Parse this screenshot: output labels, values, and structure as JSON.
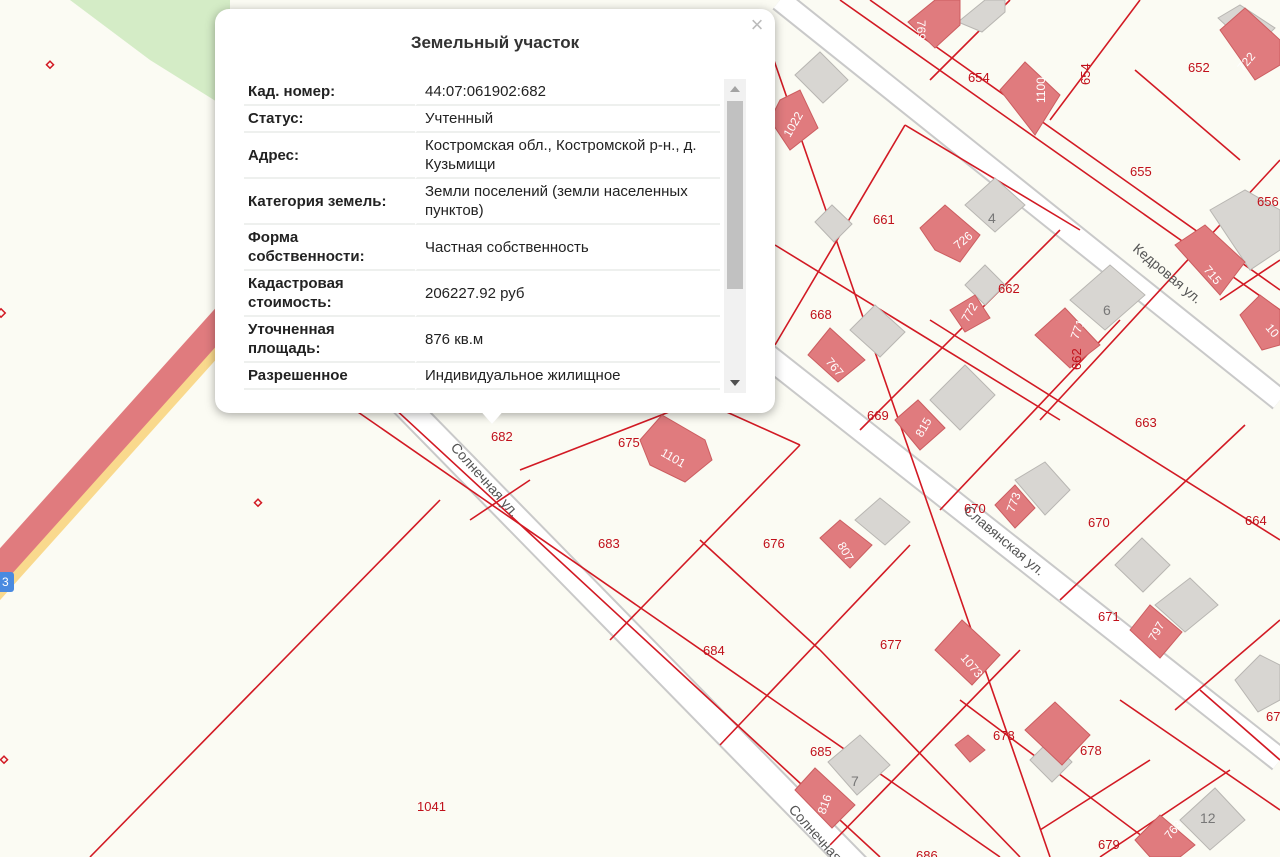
{
  "popup": {
    "title": "Земельный участок",
    "close_symbol": "×",
    "rows": [
      {
        "label": "Кад. номер:",
        "value": "44:07:061902:682"
      },
      {
        "label": "Статус:",
        "value": "Учтенный"
      },
      {
        "label": "Адрес:",
        "value": "Костромская обл., Костромской р-н., д. Кузьмищи"
      },
      {
        "label": "Категория земель:",
        "value": "Земли поселений (земли населенных пунктов)"
      },
      {
        "label": "Форма собственности:",
        "value": "Частная собственность"
      },
      {
        "label": "Кадастровая стоимость:",
        "value": "206227.92 руб"
      },
      {
        "label": "Уточненная площадь:",
        "value": "876 кв.м"
      },
      {
        "label": "Разрешенное",
        "value": "Индивидуальное жилищное"
      }
    ]
  },
  "map": {
    "road_badge": "3",
    "streets": [
      "Солнечная ул.",
      "Славянская ул.",
      "Кедровая ул.",
      "Солнечная ул."
    ],
    "plot_numbers": [
      "682",
      "675",
      "683",
      "676",
      "684",
      "677",
      "685",
      "678",
      "678",
      "679",
      "686",
      "1041",
      "668",
      "669",
      "670",
      "670",
      "671",
      "661",
      "662",
      "663",
      "664",
      "654",
      "654",
      "655",
      "652",
      "656",
      "67",
      "662"
    ],
    "building_numbers": [
      "769",
      "1100",
      "722",
      "1022",
      "726",
      "715",
      "772",
      "771",
      "767",
      "815",
      "773",
      "797",
      "807",
      "1073",
      "816",
      "763",
      "1101",
      "10"
    ],
    "house_numbers": [
      "4",
      "6",
      "7",
      "12"
    ]
  },
  "colors": {
    "boundary": "#d21a24",
    "building": "#e07b7e",
    "building_gray": "#d8d6d2",
    "road_fill": "#ffffff",
    "highway": "#e07b7e",
    "highway_edge": "#f9d98d",
    "park": "#d4ecc6",
    "background": "#fbfbf3"
  }
}
